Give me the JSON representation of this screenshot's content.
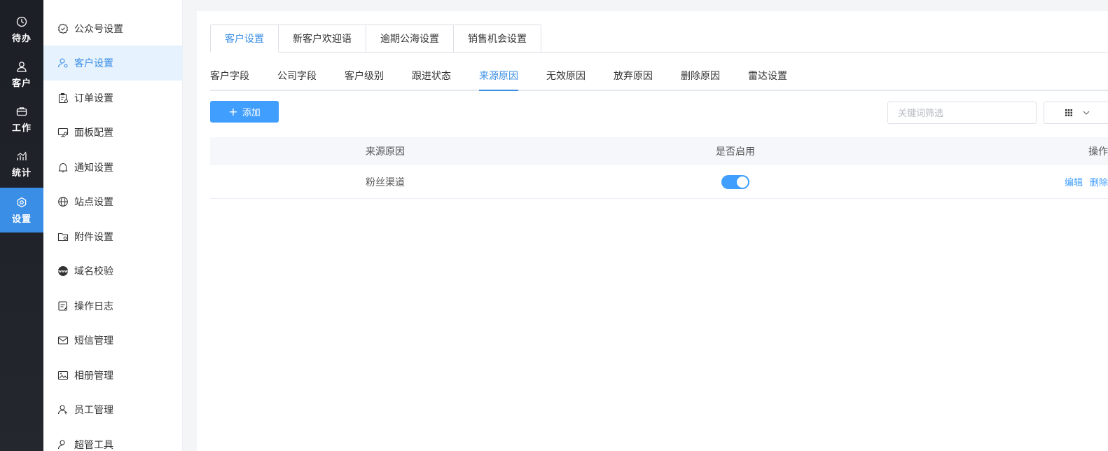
{
  "rail": [
    {
      "label": "待办",
      "icon": "clock-icon"
    },
    {
      "label": "客户",
      "icon": "user-icon"
    },
    {
      "label": "工作",
      "icon": "briefcase-icon"
    },
    {
      "label": "统计",
      "icon": "chart-icon"
    },
    {
      "label": "设置",
      "icon": "gear-icon",
      "active": true
    }
  ],
  "sidebar": [
    {
      "label": "公众号设置",
      "icon": "badge-check-icon"
    },
    {
      "label": "客户设置",
      "icon": "user-settings-icon",
      "active": true
    },
    {
      "label": "订单设置",
      "icon": "clipboard-icon"
    },
    {
      "label": "面板配置",
      "icon": "monitor-icon"
    },
    {
      "label": "通知设置",
      "icon": "bell-icon"
    },
    {
      "label": "站点设置",
      "icon": "globe-icon"
    },
    {
      "label": "附件设置",
      "icon": "folder-icon"
    },
    {
      "label": "域名校验",
      "icon": "www-icon"
    },
    {
      "label": "操作日志",
      "icon": "log-icon"
    },
    {
      "label": "短信管理",
      "icon": "mail-icon"
    },
    {
      "label": "相册管理",
      "icon": "image-icon"
    },
    {
      "label": "员工管理",
      "icon": "user-manage-icon"
    },
    {
      "label": "超管工具",
      "icon": "admin-icon"
    }
  ],
  "top_tabs": [
    "客户设置",
    "新客户欢迎语",
    "逾期公海设置",
    "销售机会设置"
  ],
  "sub_tabs": [
    "客户字段",
    "公司字段",
    "客户级别",
    "跟进状态",
    "来源原因",
    "无效原因",
    "放弃原因",
    "删除原因",
    "雷达设置"
  ],
  "active_sub_tab": "来源原因",
  "toolbar": {
    "add_label": "添加",
    "search_placeholder": "关键词筛选"
  },
  "table": {
    "headers": [
      "来源原因",
      "是否启用",
      "操作"
    ],
    "rows": [
      {
        "reason": "粉丝渠道",
        "enabled": true,
        "actions": [
          "编辑",
          "删除"
        ]
      }
    ]
  },
  "colors": {
    "accent": "#409eff",
    "rail_bg": "#1c1f26",
    "active_side_bg": "#e6f2fd"
  }
}
